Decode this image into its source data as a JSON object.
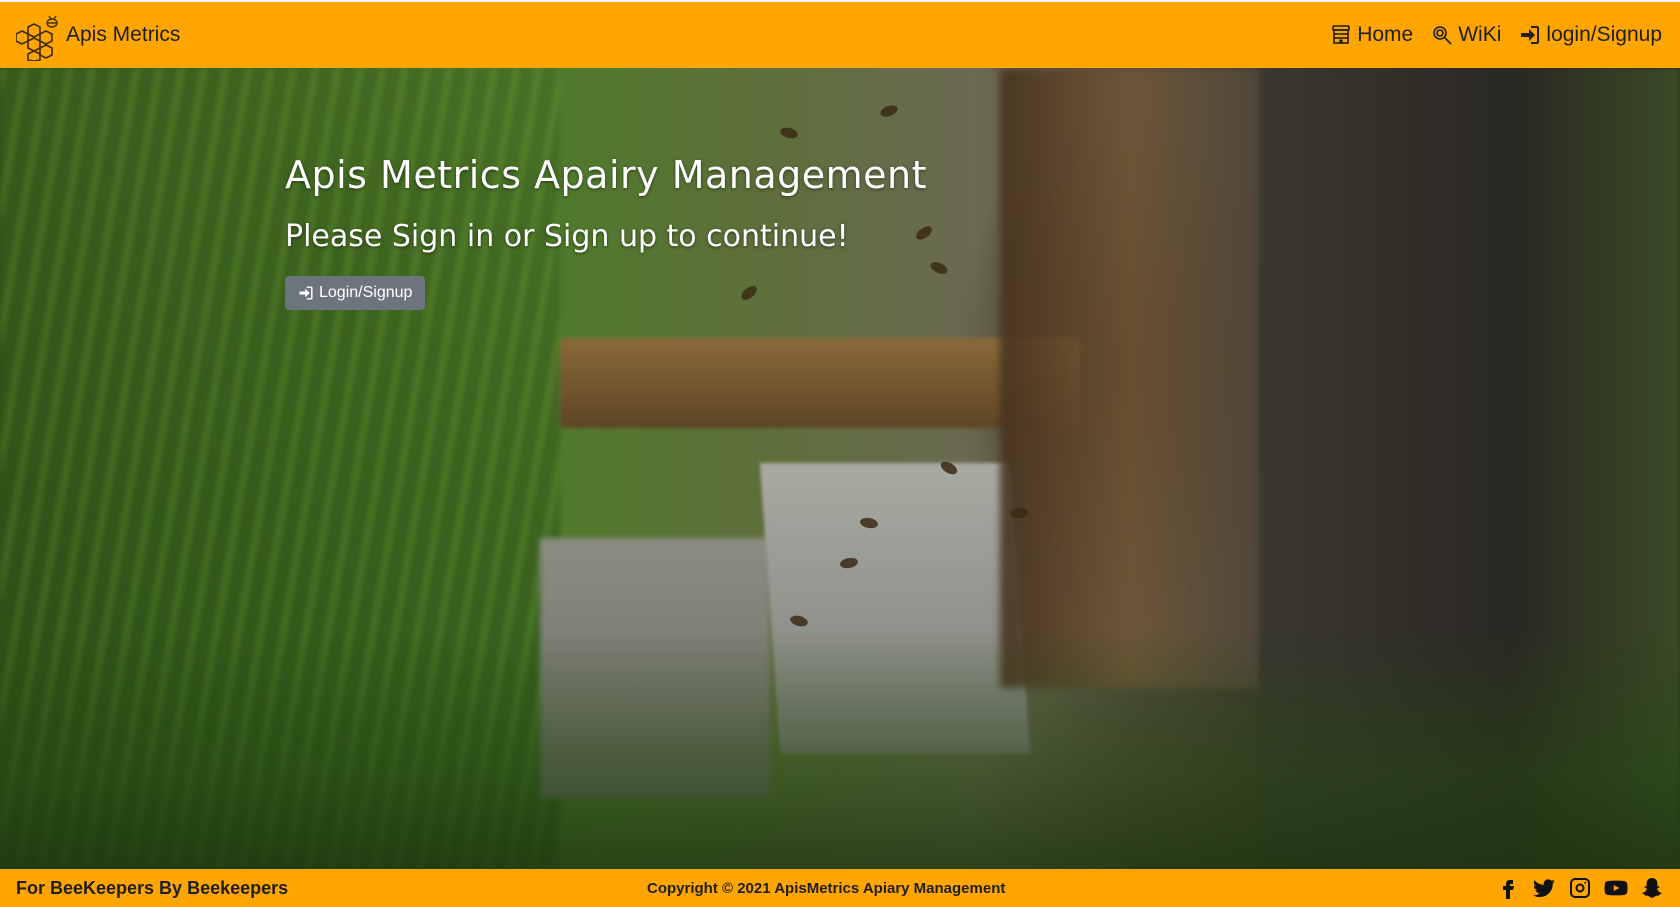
{
  "navbar": {
    "brand_name": "Apis Metrics",
    "logo_icon": "honeycomb-bee-icon",
    "links": [
      {
        "label": "Home",
        "icon": "beehive-icon"
      },
      {
        "label": "WiKi",
        "icon": "magnifier-icon"
      },
      {
        "label": "login/Signup",
        "icon": "sign-in-icon"
      }
    ]
  },
  "hero": {
    "title": "Apis Metrics Apairy Management",
    "subtitle": "Please Sign in or Sign up to continue!",
    "button_label": "Login/Signup",
    "button_icon": "sign-in-icon"
  },
  "footer": {
    "tagline": "For BeeKeepers By Beekeepers",
    "copyright": "Copyright © 2021 ApisMetrics Apiary Management",
    "socials": [
      "facebook-icon",
      "twitter-icon",
      "instagram-icon",
      "youtube-icon",
      "snapchat-icon"
    ]
  },
  "colors": {
    "accent": "#ffa500",
    "button": "#6c757d",
    "text_dark": "#1f1f1f",
    "text_light": "#ffffff"
  }
}
